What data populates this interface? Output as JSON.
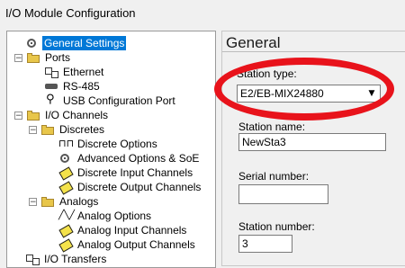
{
  "window": {
    "title": "I/O Module Configuration"
  },
  "tree": {
    "items": [
      {
        "label": "General Settings",
        "expander": "",
        "icon": "grid-icon"
      },
      {
        "label": "Ports",
        "expander": "−",
        "icon": "folder-icon"
      },
      {
        "label": "Ethernet",
        "expander": "",
        "icon": "network-icon"
      },
      {
        "label": "RS-485",
        "expander": "",
        "icon": "serial-port-icon"
      },
      {
        "label": "USB Configuration Port",
        "expander": "",
        "icon": "usb-icon"
      },
      {
        "label": "I/O Channels",
        "expander": "−",
        "icon": "folder-icon"
      },
      {
        "label": "Discretes",
        "expander": "−",
        "icon": "folder-icon"
      },
      {
        "label": "Discrete Options",
        "expander": "",
        "icon": "pulse-icon"
      },
      {
        "label": "Advanced Options & SoE",
        "expander": "",
        "icon": "gear-icon"
      },
      {
        "label": "Discrete Input Channels",
        "expander": "",
        "icon": "tag-icon"
      },
      {
        "label": "Discrete Output Channels",
        "expander": "",
        "icon": "tag-icon"
      },
      {
        "label": "Analogs",
        "expander": "−",
        "icon": "folder-icon"
      },
      {
        "label": "Analog Options",
        "expander": "",
        "icon": "wave-icon"
      },
      {
        "label": "Analog Input Channels",
        "expander": "",
        "icon": "tag-icon"
      },
      {
        "label": "Analog Output Channels",
        "expander": "",
        "icon": "tag-icon"
      },
      {
        "label": "I/O Transfers",
        "expander": "",
        "icon": "transfer-icon"
      }
    ]
  },
  "general": {
    "title": "General",
    "station_type_label": "Station type:",
    "station_type_value": "E2/EB-MIX24880",
    "station_name_label": "Station name:",
    "station_name_value": "NewSta3",
    "serial_number_label": "Serial number:",
    "serial_number_value": "",
    "station_number_label": "Station number:",
    "station_number_value": "3"
  },
  "colors": {
    "selection": "#0078d7",
    "highlight_ring": "#e8131b"
  }
}
